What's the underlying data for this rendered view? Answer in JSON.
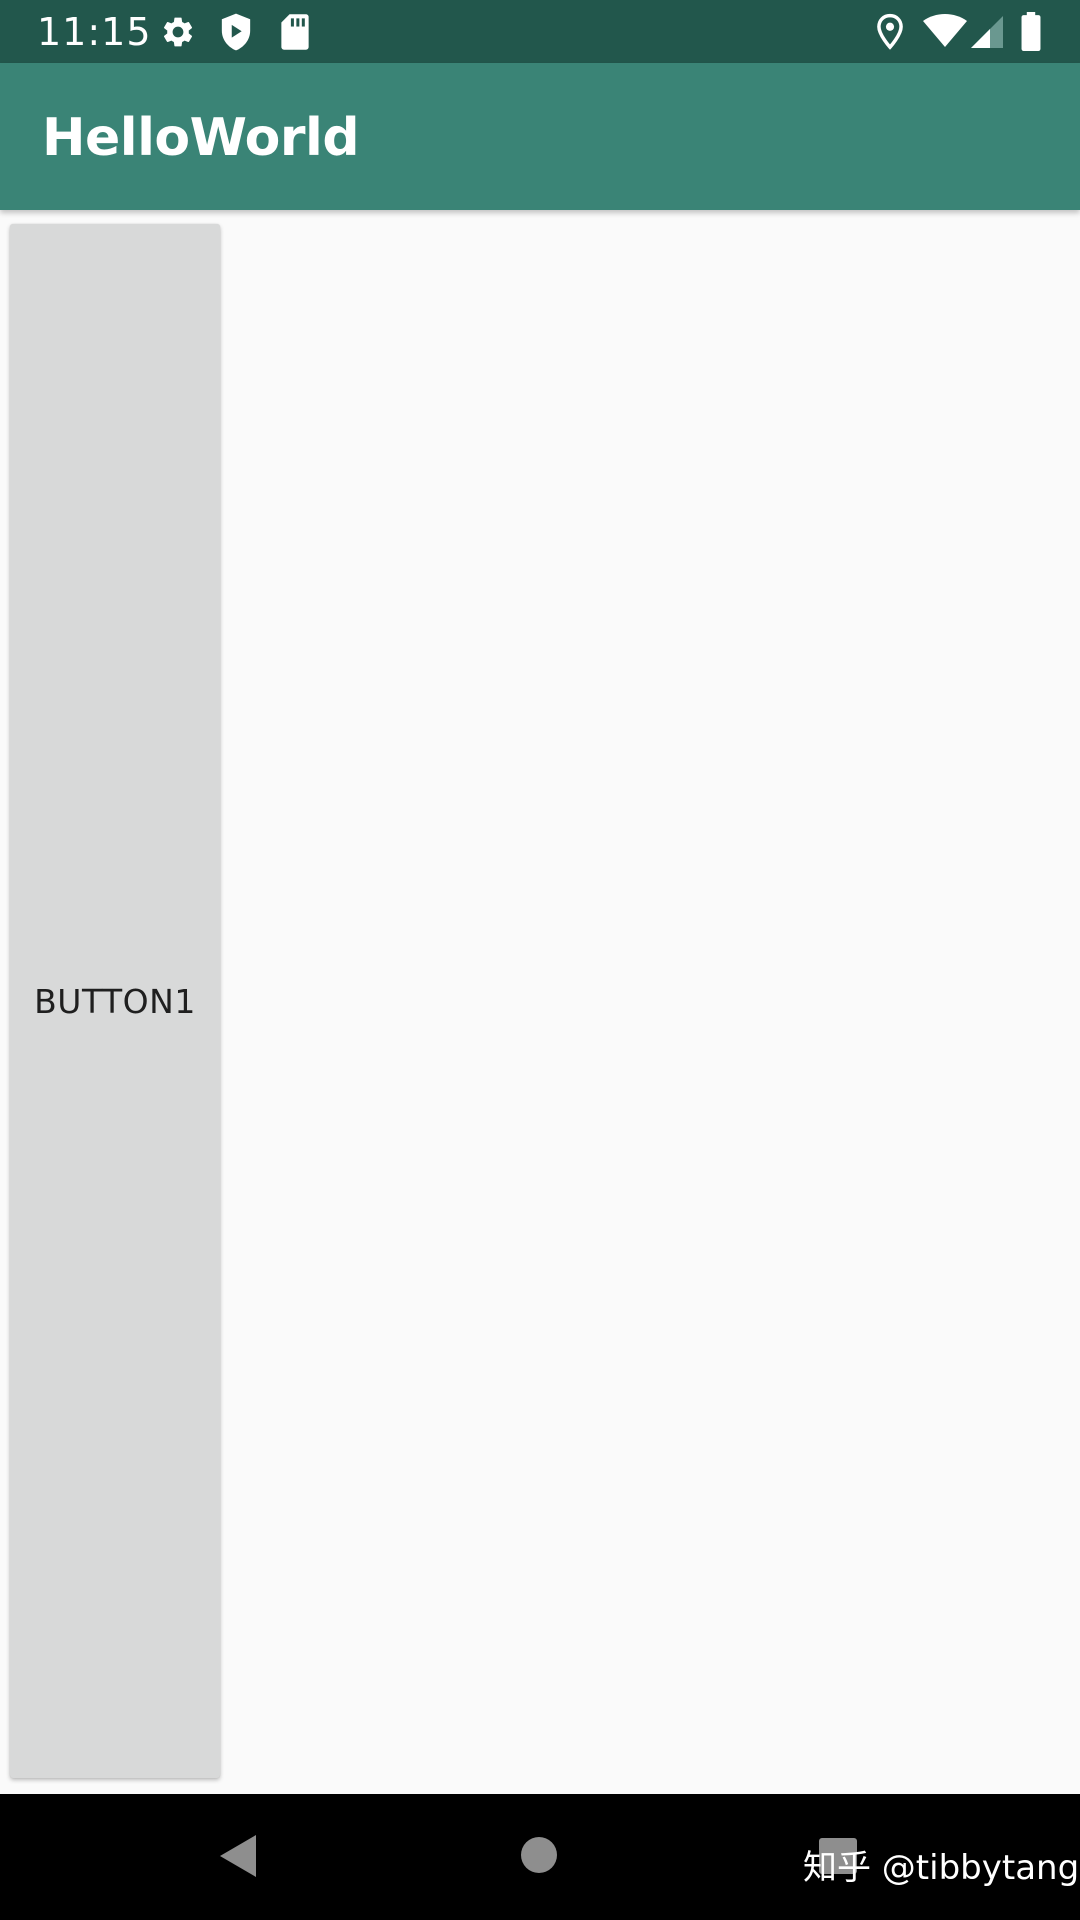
{
  "status_bar": {
    "time": "11:15",
    "left_icons": [
      "gear-icon",
      "shield-icon",
      "sd-card-icon"
    ],
    "right_icons": [
      "location-pin-icon",
      "wifi-icon",
      "cell-signal-icon",
      "battery-icon"
    ]
  },
  "app_bar": {
    "title": "HelloWorld"
  },
  "content": {
    "button1_label": "BUTTON1"
  },
  "nav_bar": {
    "buttons": [
      "back-icon",
      "home-icon",
      "recents-icon"
    ]
  },
  "watermark": {
    "text": "知乎 @tibbytang"
  },
  "colors": {
    "status_bar": "#22574c",
    "app_bar": "#3a8476",
    "background": "#fafafa",
    "button": "#d8d9d9",
    "nav_bar": "#000000"
  }
}
